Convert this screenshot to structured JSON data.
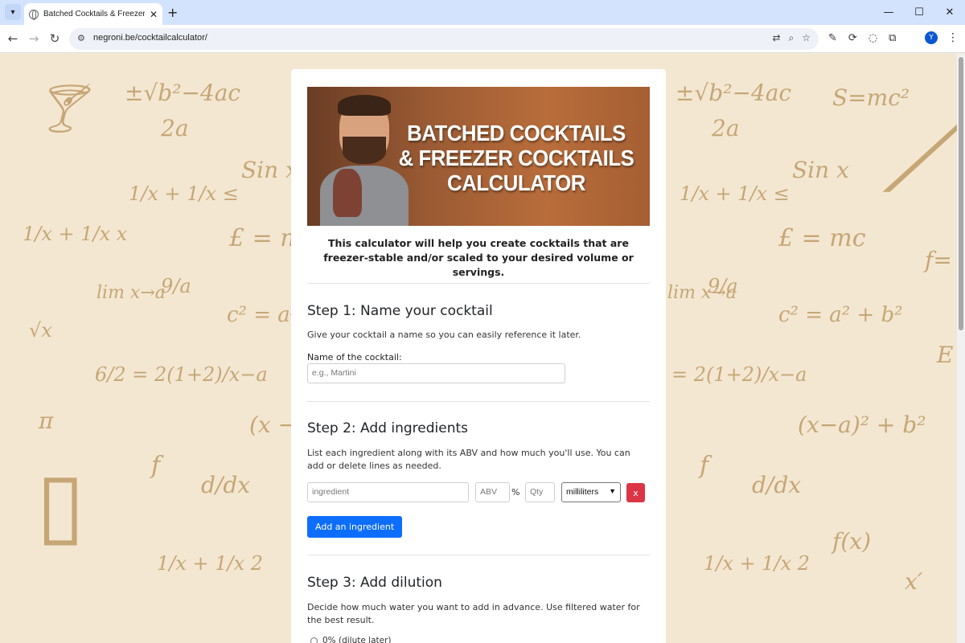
{
  "browser": {
    "tab_title": "Batched Cocktails & Freezer Co",
    "url": "negroni.be/cocktailcalculator/",
    "new_tab_symbol": "+",
    "close_symbol": "✕",
    "profile_initial": "Y",
    "icons": [
      "tab-search-icon",
      "globe-icon",
      "back-icon",
      "forward-icon",
      "reload-icon",
      "site-info-icon",
      "translate-icon",
      "zoom-icon",
      "star-icon",
      "pen-icon",
      "sync-icon",
      "eye-off-icon",
      "extensions-icon",
      "more-icon"
    ]
  },
  "hero": {
    "title": "BATCHED COCKTAILS & FREEZER COCKTAILS CALCULATOR"
  },
  "intro": "This calculator will help you create cocktails that are freezer-stable and/or scaled to your desired volume or servings.",
  "step1": {
    "heading": "Step 1: Name your cocktail",
    "description": "Give your cocktail a name so you can easily reference it later.",
    "label": "Name of the cocktail:",
    "placeholder": "e.g., Martini"
  },
  "step2": {
    "heading": "Step 2: Add ingredients",
    "description": "List each ingredient along with its ABV and how much you'll use. You can add or delete lines as needed.",
    "ingredient_placeholder": "ingredient",
    "abv_placeholder": "ABV",
    "percent_symbol": "%",
    "qty_placeholder": "Qty",
    "unit_selected": "milliliters",
    "remove_label": "x",
    "add_button": "Add an ingredient"
  },
  "step3": {
    "heading": "Step 3: Add dilution",
    "description": "Decide how much water you want to add in advance. Use filtered water for the best result.",
    "first_option": "0% (dilute later)"
  },
  "background_doodles": {
    "quadratic_top": "±√b²−4ac",
    "quadratic_bottom": "2a",
    "emc": "S=mc²",
    "sinx": "Sin x",
    "frac_sum": "1/x + 1/x ≤",
    "frac_sum2": "1/x + 1/x x",
    "e_mc": "£ = mc",
    "lim": "lim x→a",
    "nine_a": "9/a",
    "pythag": "c² = a² + b²",
    "sqrt_x": "√x",
    "six_two": "6/2 = 2(1+2)/x−a",
    "pi": "π",
    "circle": "(x−a)² + b²",
    "f": "f",
    "ddx": "d/dx",
    "fx": "f(x)",
    "frac_sum3": "1/x + 1/x 2",
    "x_prime": "x′",
    "E": "E",
    "f_eq": "f="
  }
}
